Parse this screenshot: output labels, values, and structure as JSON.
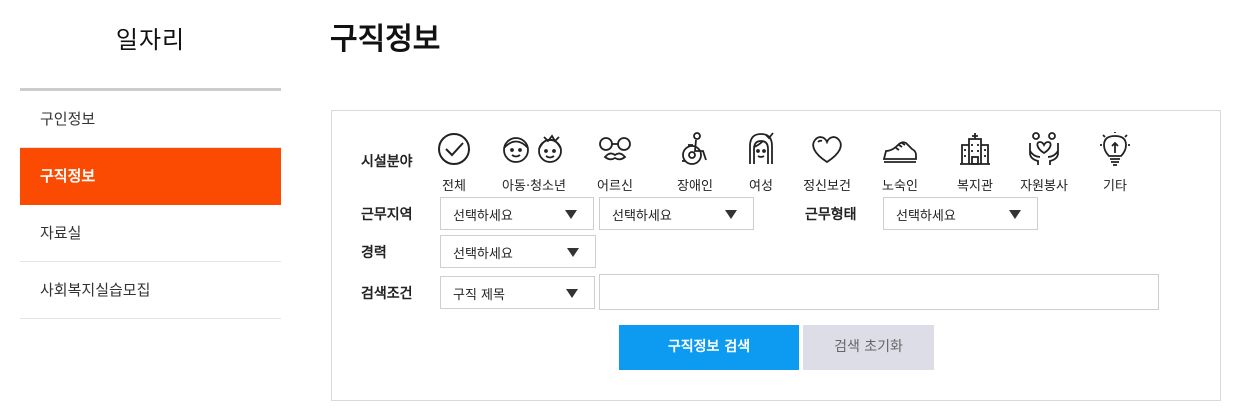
{
  "sidebar": {
    "title": "일자리",
    "items": [
      {
        "label": "구인정보",
        "active": false
      },
      {
        "label": "구직정보",
        "active": true
      },
      {
        "label": "자료실",
        "active": false
      },
      {
        "label": "사회복지실습모집",
        "active": false
      }
    ]
  },
  "page": {
    "title": "구직정보"
  },
  "search": {
    "facility_label": "시설분야",
    "categories": [
      {
        "label": "전체",
        "icon": "check-circle-icon"
      },
      {
        "label": "아동·청소년",
        "icon": "children-icon"
      },
      {
        "label": "어르신",
        "icon": "elder-glasses-icon"
      },
      {
        "label": "장애인",
        "icon": "wheelchair-icon"
      },
      {
        "label": "여성",
        "icon": "woman-icon"
      },
      {
        "label": "정신보건",
        "icon": "heart-icon"
      },
      {
        "label": "노숙인",
        "icon": "shoe-icon"
      },
      {
        "label": "복지관",
        "icon": "building-icon"
      },
      {
        "label": "자원봉사",
        "icon": "helping-hands-icon"
      },
      {
        "label": "기타",
        "icon": "lightbulb-icon"
      }
    ],
    "region_label": "근무지역",
    "region_select_1": "선택하세요",
    "region_select_2": "선택하세요",
    "worktype_label": "근무형태",
    "worktype_select": "선택하세요",
    "career_label": "경력",
    "career_select": "선택하세요",
    "condition_label": "검색조건",
    "condition_select": "구직 제목",
    "keyword_value": "",
    "search_button": "구직정보 검색",
    "reset_button": "검색 초기화"
  },
  "colors": {
    "accent": "#fb4b03",
    "primary_button": "#0d9bf2",
    "secondary_button": "#dcdde6"
  }
}
